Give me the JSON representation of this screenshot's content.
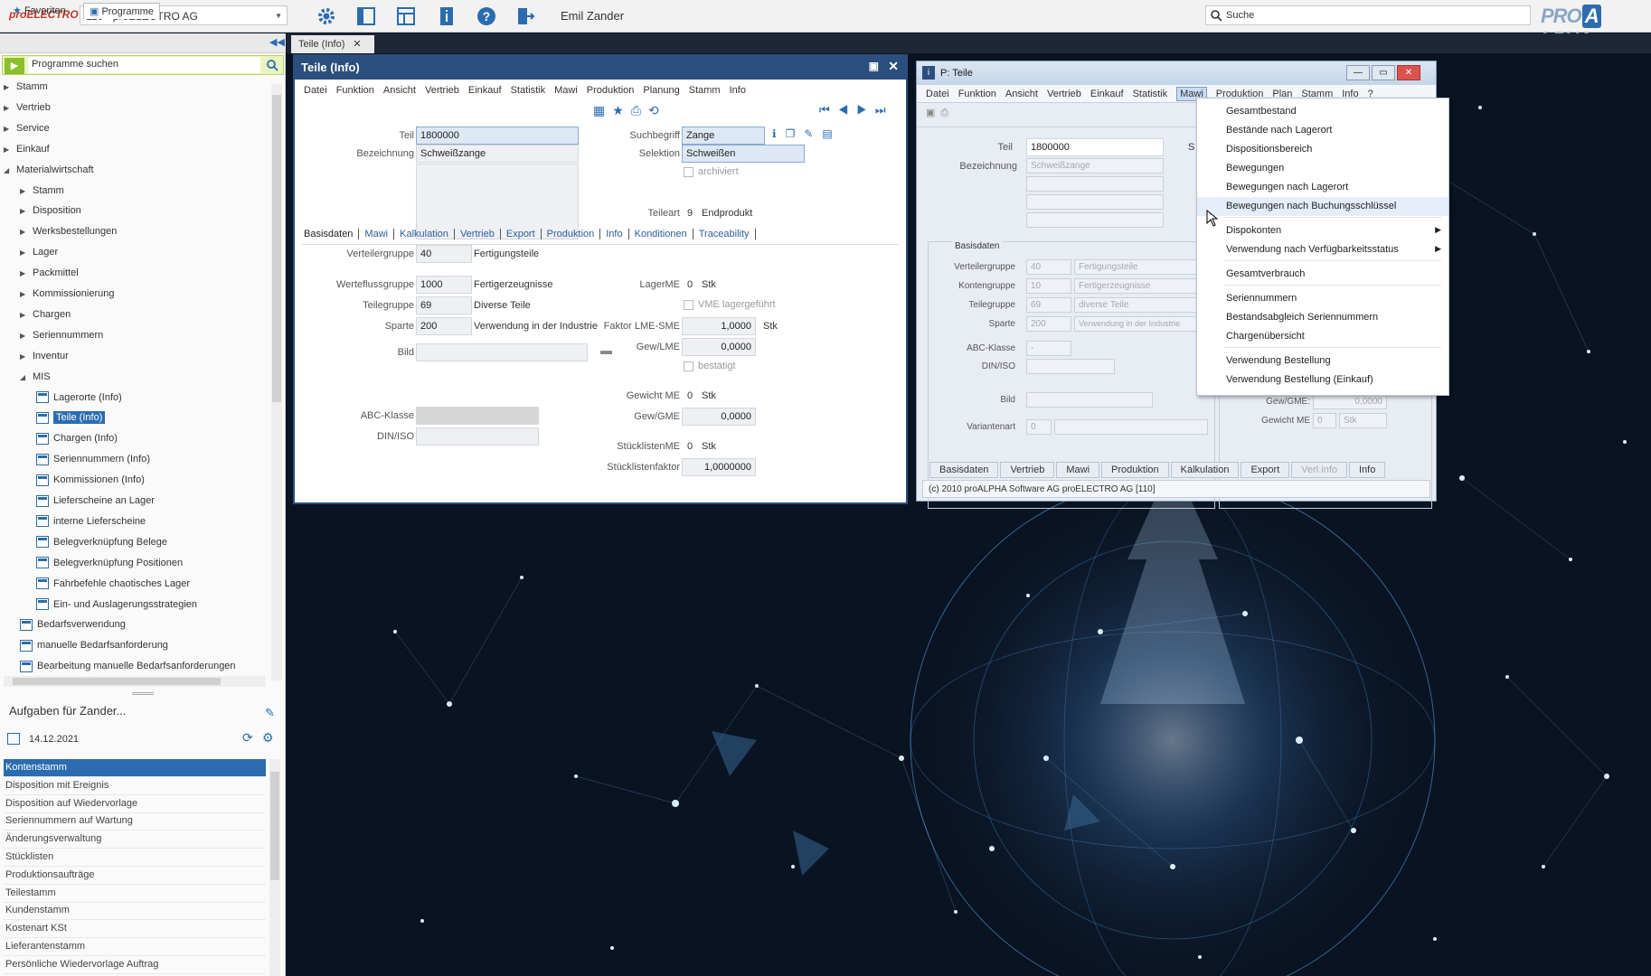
{
  "topbar": {
    "brand": "proELECTRO",
    "company": "110 - proELECTRO AG",
    "user": "Emil Zander",
    "search_placeholder": "Suche",
    "logo_left": "PRO",
    "logo_mid": "A",
    "logo_right": "LPHA"
  },
  "left": {
    "tab_favoriten": "Favoriten",
    "tab_programme": "Programme",
    "program_search": "Programme suchen",
    "tree": [
      {
        "label": "Stamm",
        "level": 0,
        "type": "folder",
        "open": false
      },
      {
        "label": "Vertrieb",
        "level": 0,
        "type": "folder",
        "open": false
      },
      {
        "label": "Service",
        "level": 0,
        "type": "folder",
        "open": false
      },
      {
        "label": "Einkauf",
        "level": 0,
        "type": "folder",
        "open": false
      },
      {
        "label": "Materialwirtschaft",
        "level": 0,
        "type": "folder",
        "open": true
      },
      {
        "label": "Stamm",
        "level": 1,
        "type": "folder",
        "open": false
      },
      {
        "label": "Disposition",
        "level": 1,
        "type": "folder",
        "open": false
      },
      {
        "label": "Werksbestellungen",
        "level": 1,
        "type": "folder",
        "open": false
      },
      {
        "label": "Lager",
        "level": 1,
        "type": "folder",
        "open": false
      },
      {
        "label": "Packmittel",
        "level": 1,
        "type": "folder",
        "open": false
      },
      {
        "label": "Kommissionierung",
        "level": 1,
        "type": "folder",
        "open": false
      },
      {
        "label": "Chargen",
        "level": 1,
        "type": "folder",
        "open": false
      },
      {
        "label": "Seriennummern",
        "level": 1,
        "type": "folder",
        "open": false
      },
      {
        "label": "Inventur",
        "level": 1,
        "type": "folder",
        "open": false
      },
      {
        "label": "MIS",
        "level": 1,
        "type": "folder",
        "open": true
      },
      {
        "label": "Lagerorte (Info)",
        "level": 2,
        "type": "info"
      },
      {
        "label": "Teile (Info)",
        "level": 2,
        "type": "info",
        "selected": true
      },
      {
        "label": "Chargen (Info)",
        "level": 2,
        "type": "info"
      },
      {
        "label": "Seriennummern (Info)",
        "level": 2,
        "type": "info"
      },
      {
        "label": "Kommissionen (Info)",
        "level": 2,
        "type": "info"
      },
      {
        "label": "Lieferscheine an Lager",
        "level": 2,
        "type": "win"
      },
      {
        "label": "interne Lieferscheine",
        "level": 2,
        "type": "win"
      },
      {
        "label": "Belegverknüpfung Belege",
        "level": 2,
        "type": "info"
      },
      {
        "label": "Belegverknüpfung Positionen",
        "level": 2,
        "type": "info"
      },
      {
        "label": "Fahrbefehle chaotisches Lager",
        "level": 2,
        "type": "win"
      },
      {
        "label": "Ein- und Auslagerungsstrategien",
        "level": 2,
        "type": "tool"
      },
      {
        "label": "Bedarfsverwendung",
        "level": 1,
        "type": "win"
      },
      {
        "label": "manuelle Bedarfsanforderung",
        "level": 1,
        "type": "win"
      },
      {
        "label": "Bearbeitung manuelle Bedarfsanforderungen",
        "level": 1,
        "type": "win"
      }
    ],
    "tasks_title": "Aufgaben für Zander...",
    "tasks_date": "14.12.2021",
    "tasks": [
      "Kontenstamm",
      "Disposition mit Ereignis",
      "Disposition auf Wiedervorlage",
      "Seriennummern auf Wartung",
      "Änderungsverwaltung",
      "Stücklisten",
      "Produktionsaufträge",
      "Teilestamm",
      "Kundenstamm",
      "Kostenart KSt",
      "Lieferantenstamm",
      "Persönliche Wiedervorlage Auftrag"
    ]
  },
  "doctab": {
    "label": "Teile (Info)"
  },
  "win1": {
    "title": "Teile (Info)",
    "menu": [
      "Datei",
      "Funktion",
      "Ansicht",
      "Vertrieb",
      "Einkauf",
      "Statistik",
      "Mawi",
      "Produktion",
      "Planung",
      "Stamm",
      "Info"
    ],
    "teil_label": "Teil",
    "teil_value": "1800000",
    "bezeichnung_label": "Bezeichnung",
    "bezeichnung_value": "Schweißzange",
    "suchbegriff_label": "Suchbegriff",
    "suchbegriff_value": "Zange",
    "selektion_label": "Selektion",
    "selektion_value": "Schweißen",
    "archiviert_label": "archiviert",
    "teileart_label": "Teileart",
    "teileart_value": "9",
    "teileart_text": "Endprodukt",
    "tabs": [
      "Basisdaten",
      "Mawi",
      "Kalkulation",
      "Vertrieb",
      "Export",
      "Produktion",
      "Info",
      "Konditionen",
      "Traceability"
    ],
    "verteilergruppe_label": "Verteilergruppe",
    "verteilergruppe_value": "40",
    "verteilergruppe_text": "Fertigungsteile",
    "werteflussgruppe_label": "Werteflussgruppe",
    "werteflussgruppe_value": "1000",
    "werteflussgruppe_text": "Fertigerzeugnisse",
    "teilegruppe_label": "Teilegruppe",
    "teilegruppe_value": "69",
    "teilegruppe_text": "Diverse Teile",
    "sparte_label": "Sparte",
    "sparte_value": "200",
    "sparte_text": "Verwendung in der Industrie",
    "bild_label": "Bild",
    "abc_label": "ABC-Klasse",
    "din_label": "DIN/ISO",
    "lagerme_label": "LagerME",
    "lagerme_value": "0",
    "lagerme_unit": "Stk",
    "vme_label": "VME lagergeführt",
    "faktor_label": "Faktor LME-SME",
    "faktor_value": "1,0000",
    "faktor_unit": "Stk",
    "gewlme_label": "Gew/LME",
    "gewlme_value": "0,0000",
    "bestaetigt_label": "bestätigt",
    "gewichtme_label": "Gewicht ME",
    "gewichtme_value": "0",
    "gewichtme_unit": "Stk",
    "gewgme_label": "Gew/GME",
    "gewgme_value": "0,0000",
    "stuecklistenme_label": "StücklistenME",
    "stuecklistenme_value": "0",
    "stuecklistenme_unit": "Stk",
    "stuecklistenfaktor_label": "Stücklistenfaktor",
    "stuecklistenfaktor_value": "1,0000000"
  },
  "win2": {
    "title": "P: Teile",
    "menu": [
      "Datei",
      "Funktion",
      "Ansicht",
      "Vertrieb",
      "Einkauf",
      "Statistik",
      "Mawi",
      "Produktion",
      "Plan",
      "Stamm",
      "Info",
      "?"
    ],
    "active_menu": "Mawi",
    "teil_label": "Teil",
    "teil_value": "1800000",
    "bezeichnung_label": "Bezeichnung",
    "bezeichnung_value": "Schweißzange",
    "s_label": "S",
    "group_label": "Basisdaten",
    "verteilergruppe_label": "Verteilergruppe",
    "verteilergruppe_value": "40",
    "verteilergruppe_text": "Fertigungsteile",
    "kontengruppe_label": "Kontengruppe",
    "kontengruppe_value": "10",
    "kontengruppe_text": "Fertigerzeugnisse",
    "teilegruppe_label": "Teilegruppe",
    "teilegruppe_value": "69",
    "teilegruppe_text": "diverse Teile",
    "sparte_label": "Sparte",
    "sparte_value": "200",
    "sparte_text": "Verwendung in der Industrie",
    "abc_label": "ABC-Klasse",
    "abc_value": "-",
    "din_label": "DIN/ISO",
    "bild_label": "Bild",
    "variantenart_label": "Variantenart",
    "variantenart_value": "0",
    "gewgme_label": "Gew/GME:",
    "gewgme_value": "0,0000",
    "gewichtme_label": "Gewicht ME",
    "gewichtme_value": "0",
    "gewichtme_unit": "Stk",
    "btabs": [
      "Basisdaten",
      "Vertrieb",
      "Mawi",
      "Produktion",
      "Kalkulation",
      "Export",
      "Verl.info",
      "Info"
    ],
    "status": "(c) 2010 proALPHA Software AG  proELECTRO AG [110]"
  },
  "dropdown": {
    "items": [
      {
        "label": "Gesamtbestand"
      },
      {
        "label": "Bestände nach Lagerort"
      },
      {
        "label": "Dispositionsbereich"
      },
      {
        "label": "Bewegungen"
      },
      {
        "label": "Bewegungen nach Lagerort"
      },
      {
        "label": "Bewegungen nach Buchungsschlüssel",
        "hover": true
      },
      {
        "label": "Dispokonten",
        "sub": true,
        "sep_before": true
      },
      {
        "label": "Verwendung nach Verfügbarkeitsstatus",
        "sub": true
      },
      {
        "label": "Gesamtverbrauch",
        "sep_before": true
      },
      {
        "label": "Seriennummern",
        "sep_before": true
      },
      {
        "label": "Bestandsabgleich Seriennummern"
      },
      {
        "label": "Chargenübersicht"
      },
      {
        "label": "Verwendung Bestellung",
        "sep_before": true
      },
      {
        "label": "Verwendung Bestellung (Einkauf)"
      }
    ]
  },
  "colors": {
    "accent": "#2a4f7e",
    "selection": "#2b6cb0",
    "brand_red": "#c0392b",
    "green": "#8bbf2c"
  }
}
